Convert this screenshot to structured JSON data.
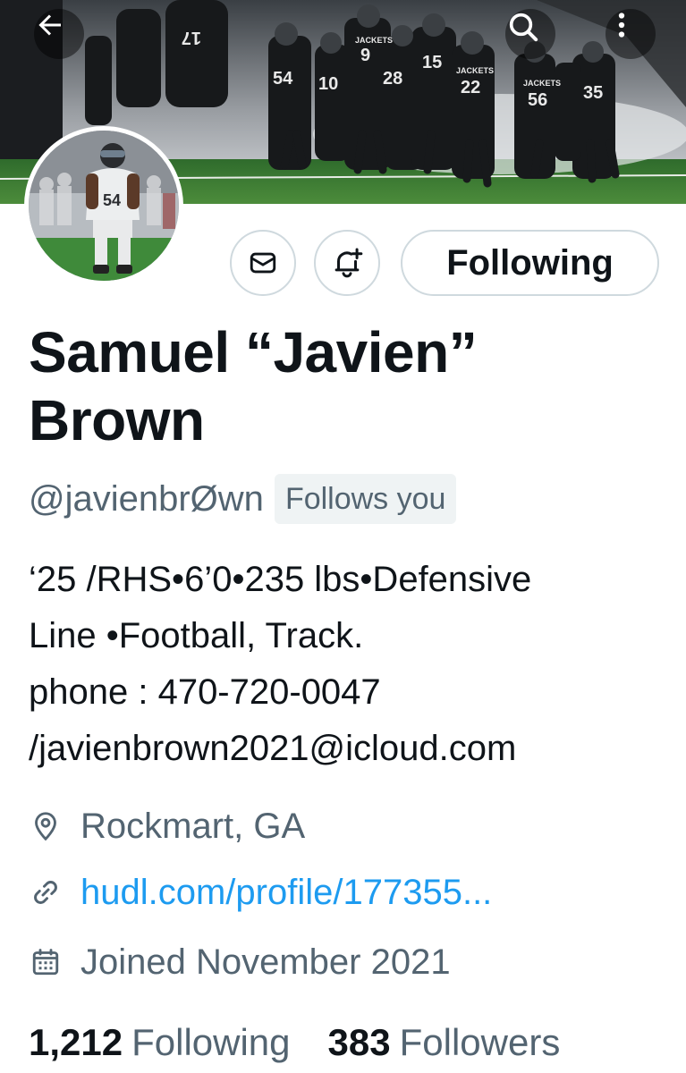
{
  "header": {
    "back_icon": "arrow-left-icon",
    "search_icon": "search-icon",
    "more_icon": "more-vertical-icon",
    "banner_jersey_numbers": [
      "9",
      "15",
      "22",
      "28",
      "54",
      "56",
      "35",
      "10",
      "17"
    ],
    "banner_jersey_text": "JACKETS"
  },
  "actions": {
    "message_icon": "mail-icon",
    "notify_icon": "bell-plus-icon",
    "following_label": "Following"
  },
  "profile": {
    "name_line1": "Samuel “Javien”",
    "name_line2": "Brown",
    "handle": "@javienbrØwn",
    "follows_you": "Follows you",
    "avatar_jersey_number": "54",
    "bio_lines": [
      "‘25 /RHS•6’0•235 lbs•Defensive",
      "Line •Football, Track.",
      "phone : 470-720-0047",
      "/javienbrown2021@icloud.com"
    ],
    "location": "Rockmart, GA",
    "website": "hudl.com/profile/177355...",
    "joined": "Joined November 2021"
  },
  "stats": {
    "following_count": "1,212",
    "following_label": "Following",
    "followers_count": "383",
    "followers_label": "Followers"
  },
  "colors": {
    "link": "#1d9bf0",
    "secondary_text": "#536471",
    "primary_text": "#0f1419",
    "border": "#cfd9de",
    "badge_bg": "#eff3f4"
  }
}
